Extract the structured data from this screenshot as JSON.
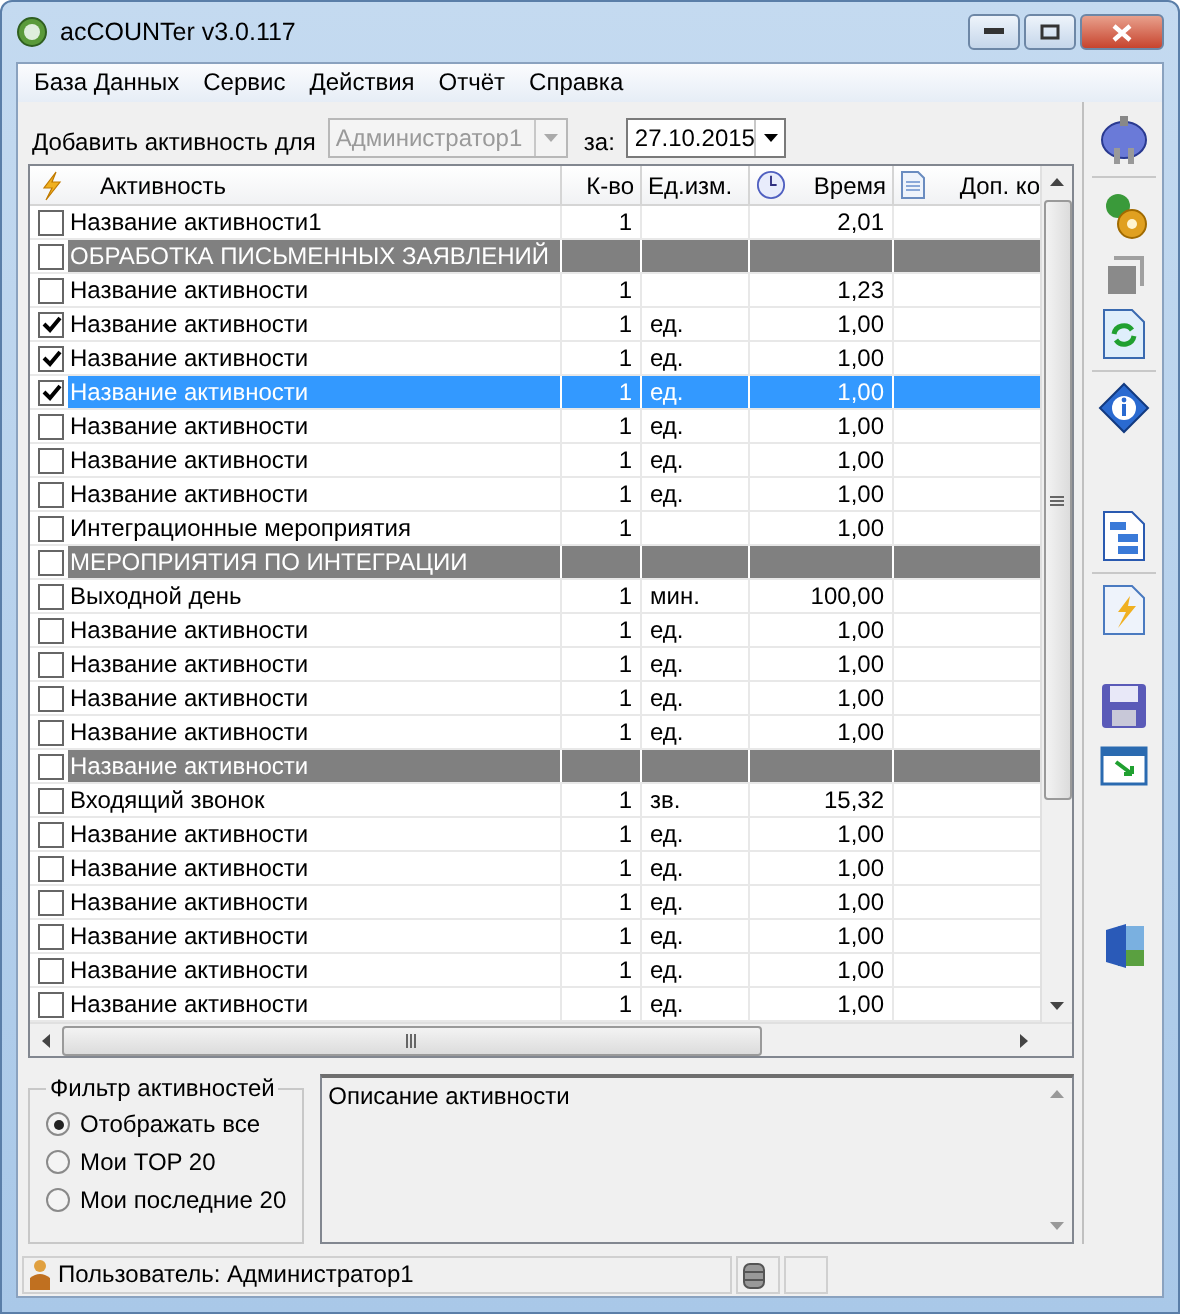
{
  "window": {
    "title": "acCOUNTer v3.0.117"
  },
  "menu": [
    "База Данных",
    "Сервис",
    "Действия",
    "Отчёт",
    "Справка"
  ],
  "add_bar": {
    "label": "Добавить активность для",
    "user": "Администратор1",
    "user_disabled": true,
    "date_label": "за:",
    "date": "27.10.2015"
  },
  "table": {
    "columns": [
      "Активность",
      "К-во",
      "Ед.изм.",
      "Время",
      "Доп. ко"
    ],
    "rows": [
      {
        "kind": "item",
        "checked": false,
        "selected": false,
        "name": "Название активности1",
        "qty": "1",
        "unit": "",
        "time": "2,01"
      },
      {
        "kind": "group",
        "checked": false,
        "selected": false,
        "name": "ОБРАБОТКА ПИСЬМЕННЫХ ЗАЯВЛЕНИЙ"
      },
      {
        "kind": "item",
        "checked": false,
        "selected": false,
        "name": "Название активности",
        "qty": "1",
        "unit": "",
        "time": "1,23"
      },
      {
        "kind": "item",
        "checked": true,
        "selected": false,
        "name": "Название активности",
        "qty": "1",
        "unit": "ед.",
        "time": "1,00"
      },
      {
        "kind": "item",
        "checked": true,
        "selected": false,
        "name": "Название активности",
        "qty": "1",
        "unit": "ед.",
        "time": "1,00"
      },
      {
        "kind": "item",
        "checked": true,
        "selected": true,
        "name": "Название активности",
        "qty": "1",
        "unit": "ед.",
        "time": "1,00"
      },
      {
        "kind": "item",
        "checked": false,
        "selected": false,
        "name": "Название активности",
        "qty": "1",
        "unit": "ед.",
        "time": "1,00"
      },
      {
        "kind": "item",
        "checked": false,
        "selected": false,
        "name": "Название активности",
        "qty": "1",
        "unit": "ед.",
        "time": "1,00"
      },
      {
        "kind": "item",
        "checked": false,
        "selected": false,
        "name": "Название активности",
        "qty": "1",
        "unit": "ед.",
        "time": "1,00"
      },
      {
        "kind": "item",
        "checked": false,
        "selected": false,
        "name": "Интеграционные мероприятия",
        "qty": "1",
        "unit": "",
        "time": "1,00"
      },
      {
        "kind": "group",
        "checked": false,
        "selected": false,
        "name": "МЕРОПРИЯТИЯ ПО ИНТЕГРАЦИИ"
      },
      {
        "kind": "item",
        "checked": false,
        "selected": false,
        "name": "Выходной день",
        "qty": "1",
        "unit": "мин.",
        "time": "100,00"
      },
      {
        "kind": "item",
        "checked": false,
        "selected": false,
        "name": "Название активности",
        "qty": "1",
        "unit": "ед.",
        "time": "1,00"
      },
      {
        "kind": "item",
        "checked": false,
        "selected": false,
        "name": "Название активности",
        "qty": "1",
        "unit": "ед.",
        "time": "1,00"
      },
      {
        "kind": "item",
        "checked": false,
        "selected": false,
        "name": "Название активности",
        "qty": "1",
        "unit": "ед.",
        "time": "1,00"
      },
      {
        "kind": "item",
        "checked": false,
        "selected": false,
        "name": "Название активности",
        "qty": "1",
        "unit": "ед.",
        "time": "1,00"
      },
      {
        "kind": "group",
        "checked": false,
        "selected": false,
        "name": "Название активности"
      },
      {
        "kind": "item",
        "checked": false,
        "selected": false,
        "name": "Входящий звонок",
        "qty": "1",
        "unit": "зв.",
        "time": "15,32"
      },
      {
        "kind": "item",
        "checked": false,
        "selected": false,
        "name": "Название активности",
        "qty": "1",
        "unit": "ед.",
        "time": "1,00"
      },
      {
        "kind": "item",
        "checked": false,
        "selected": false,
        "name": "Название активности",
        "qty": "1",
        "unit": "ед.",
        "time": "1,00"
      },
      {
        "kind": "item",
        "checked": false,
        "selected": false,
        "name": "Название активности",
        "qty": "1",
        "unit": "ед.",
        "time": "1,00"
      },
      {
        "kind": "item",
        "checked": false,
        "selected": false,
        "name": "Название активности",
        "qty": "1",
        "unit": "ед.",
        "time": "1,00"
      },
      {
        "kind": "item",
        "checked": false,
        "selected": false,
        "name": "Название активности",
        "qty": "1",
        "unit": "ед.",
        "time": "1,00"
      },
      {
        "kind": "item",
        "checked": false,
        "selected": false,
        "name": "Название активности",
        "qty": "1",
        "unit": "ед.",
        "time": "1,00"
      }
    ]
  },
  "filter": {
    "title": "Фильтр активностей",
    "options": [
      {
        "label": "Отображать все",
        "selected": true
      },
      {
        "label": "Мои TOP 20",
        "selected": false
      },
      {
        "label": "Мои последние 20",
        "selected": false
      }
    ]
  },
  "description": {
    "text": "Описание активности"
  },
  "status_bar": {
    "user": "Пользователь: Администратор1"
  }
}
